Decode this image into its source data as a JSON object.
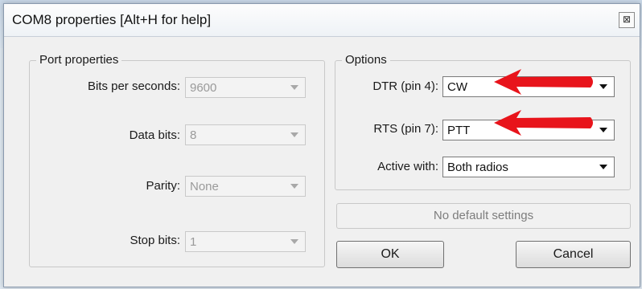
{
  "window": {
    "title": "COM8 properties [Alt+H for help]",
    "close_glyph": "⊠"
  },
  "port_properties": {
    "group_label": "Port properties",
    "bits_per_second_label": "Bits per seconds:",
    "bits_per_second_value": "9600",
    "data_bits_label": "Data bits:",
    "data_bits_value": "8",
    "parity_label": "Parity:",
    "parity_value": "None",
    "stop_bits_label": "Stop bits:",
    "stop_bits_value": "1"
  },
  "options": {
    "group_label": "Options",
    "dtr_label": "DTR (pin 4):",
    "dtr_value": "CW",
    "rts_label": "RTS (pin 7):",
    "rts_value": "PTT",
    "active_with_label": "Active with:",
    "active_with_value": "Both radios"
  },
  "buttons": {
    "no_default": "No default settings",
    "ok": "OK",
    "cancel": "Cancel"
  },
  "colors": {
    "annotation_arrow": "#e8141b"
  }
}
